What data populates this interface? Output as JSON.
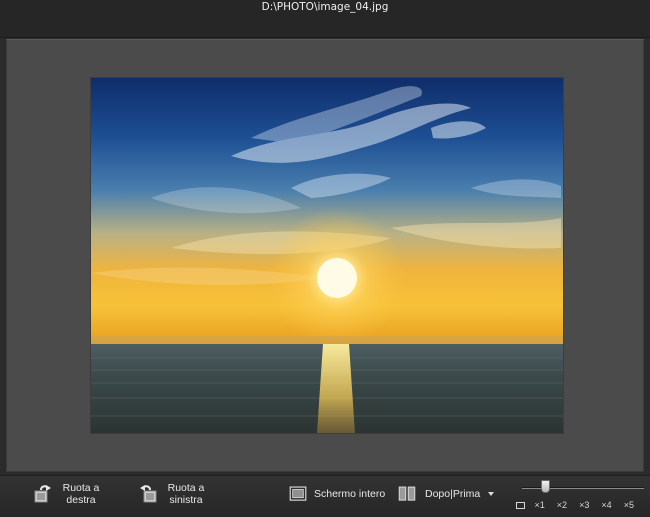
{
  "window": {
    "title": "D:\\PHOTO\\image_04.jpg"
  },
  "toolbar": {
    "rotate_right": {
      "line1": "Ruota a",
      "line2": "destra",
      "icon": "rotate-right-icon"
    },
    "rotate_left": {
      "line1": "Ruota a",
      "line2": "sinistra",
      "icon": "rotate-left-icon"
    },
    "fullscreen": {
      "label": "Schermo intero",
      "icon": "fullscreen-icon"
    },
    "compare": {
      "label_after": "Dopo",
      "separator": "|",
      "label_before": "Prima",
      "icon": "split-view-icon"
    }
  },
  "zoom": {
    "levels": [
      "×1",
      "×2",
      "×3",
      "×4",
      "×5"
    ],
    "value": 0.2
  },
  "photo": {
    "subject": "sunset-over-sea",
    "colors": {
      "sky_top": "#163a7a",
      "sky_mid": "#2c6aa8",
      "horizon": "#f2b23a",
      "sun": "#fff6c8",
      "sea": "#34403f"
    }
  }
}
